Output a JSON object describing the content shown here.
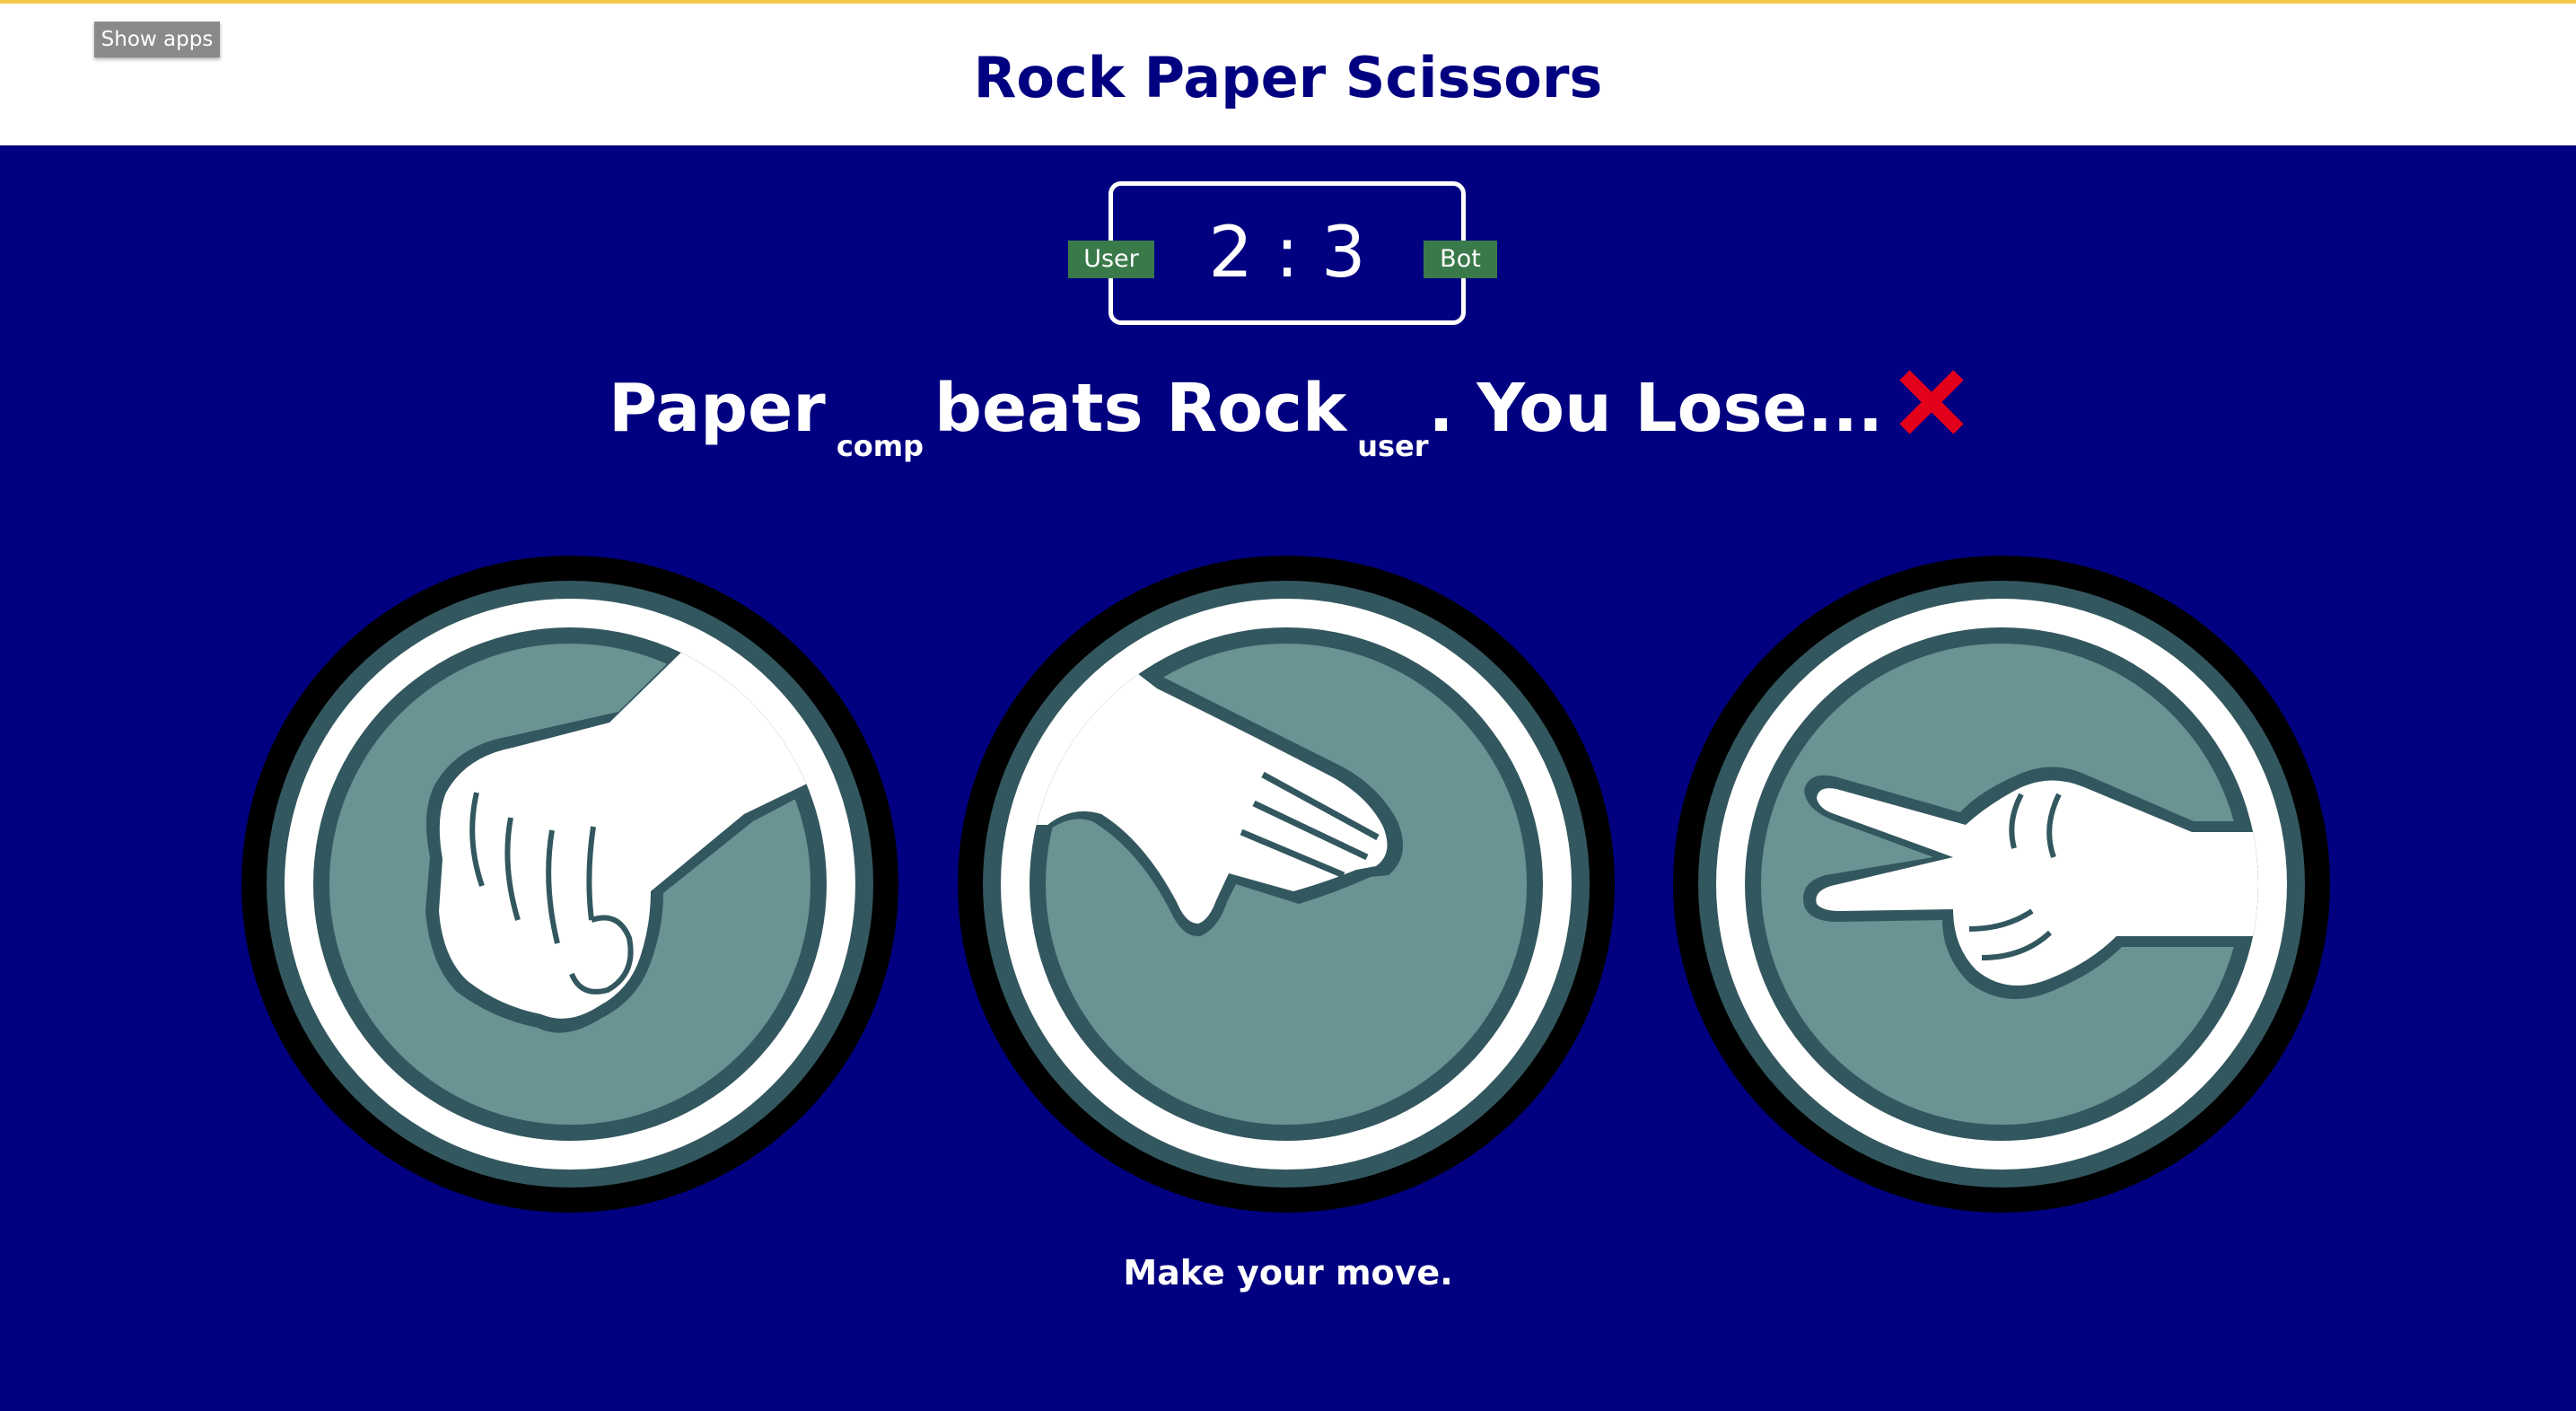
{
  "header": {
    "show_apps_label": "Show apps",
    "title": "Rock Paper Scissors"
  },
  "scoreboard": {
    "user_label": "User",
    "bot_label": "Bot",
    "user_score": "2",
    "separator": ":",
    "bot_score": "3"
  },
  "result": {
    "comp_move": "Paper",
    "comp_tag": "comp",
    "verb": "beats",
    "user_move": "Rock",
    "user_tag": "user",
    "outcome": ". You Lose...",
    "outcome_icon": "red-x-icon"
  },
  "choices": [
    {
      "name": "rock",
      "icon": "rock-hand-icon"
    },
    {
      "name": "paper",
      "icon": "paper-hand-icon"
    },
    {
      "name": "scissors",
      "icon": "scissors-hand-icon"
    }
  ],
  "prompt": "Make your move.",
  "colors": {
    "background": "#000080",
    "header_bg": "#ffffff",
    "title": "#000080",
    "badge": "#3a7a4a",
    "lose_icon": "#e3001b",
    "disc_outer": "#000000",
    "disc_ring": "#33575f",
    "disc_fill": "#6a9393",
    "accent_bar": "#f2c94c"
  }
}
